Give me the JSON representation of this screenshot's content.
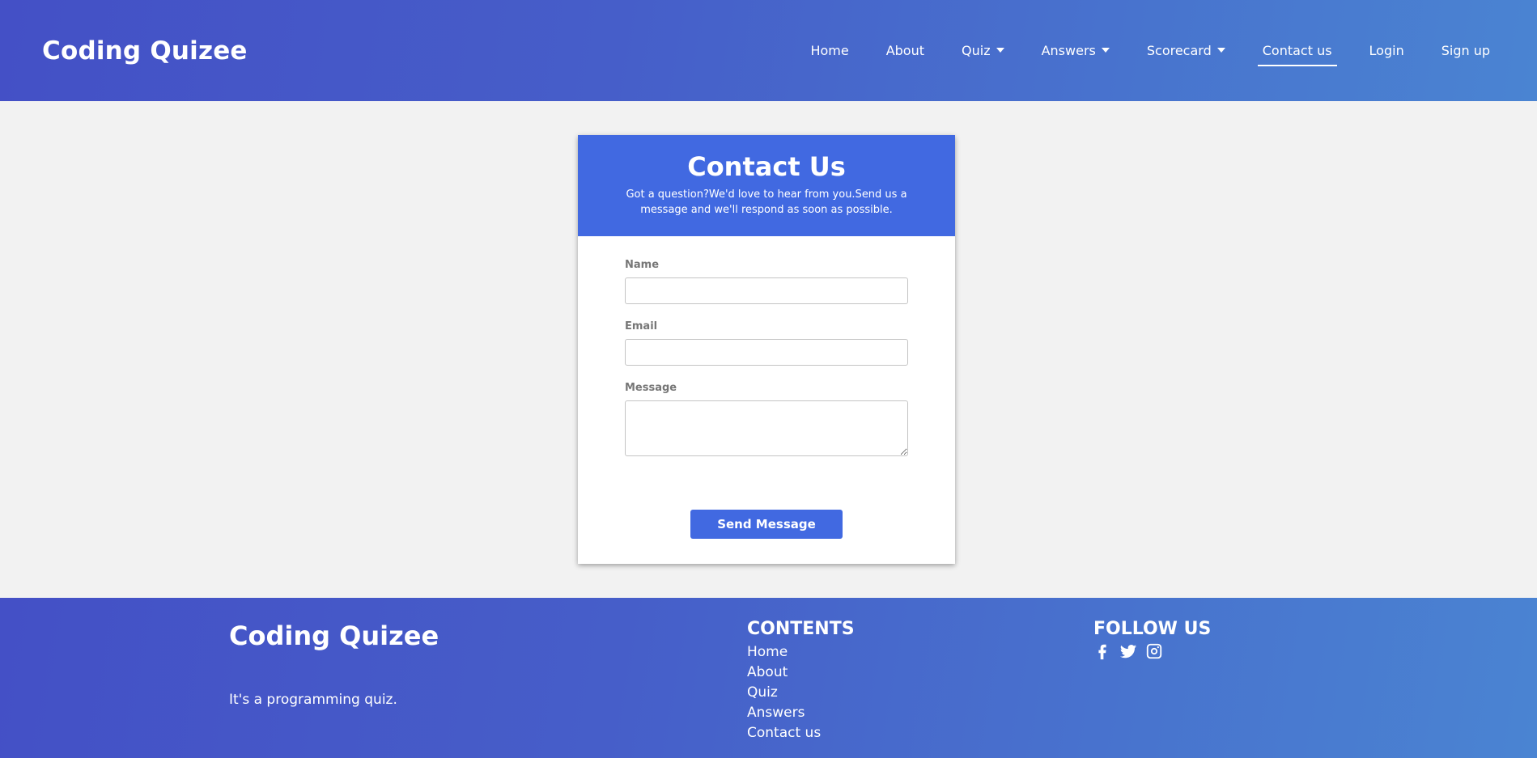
{
  "navbar": {
    "brand": "Coding Quizee",
    "items": [
      {
        "label": "Home"
      },
      {
        "label": "About"
      },
      {
        "label": "Quiz"
      },
      {
        "label": "Answers"
      },
      {
        "label": "Scorecard"
      },
      {
        "label": "Contact us"
      },
      {
        "label": "Login"
      },
      {
        "label": "Sign up"
      }
    ]
  },
  "contact": {
    "title": "Contact Us",
    "subtitle": "Got a question?We'd love to hear from you.Send us a message and we'll respond as soon as possible.",
    "name_label": "Name",
    "email_label": "Email",
    "message_label": "Message",
    "name_value": "",
    "email_value": "",
    "message_value": "",
    "send_label": "Send Message"
  },
  "footer": {
    "brand": "Coding Quizee",
    "tagline": "It's a programming quiz.",
    "contents_heading": "CONTENTS",
    "links": [
      "Home",
      "About",
      "Quiz",
      "Answers",
      "Contact us"
    ],
    "follow_heading": "FOLLOW US",
    "social": [
      "facebook-icon",
      "twitter-icon",
      "instagram-icon"
    ]
  },
  "colors": {
    "header_gradient_start": "#4450c6",
    "header_gradient_end": "#4a84d2",
    "card_header": "#4169e1",
    "button": "#4169e1",
    "page_background": "#f2f2f2"
  }
}
